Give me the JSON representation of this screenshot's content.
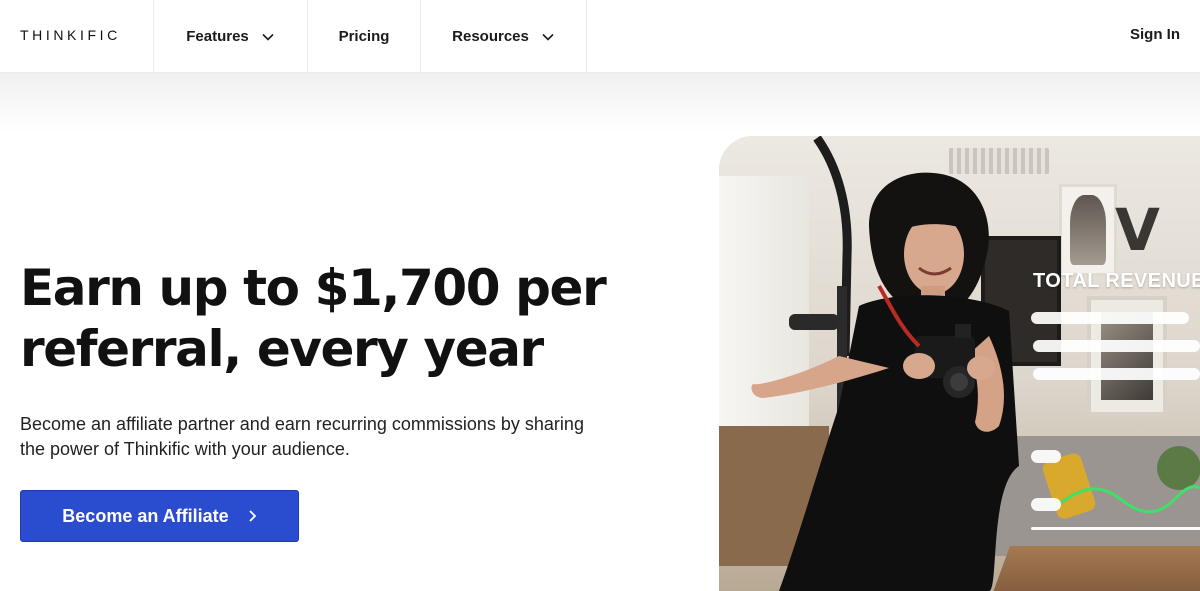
{
  "nav": {
    "logo": "THINKIFIC",
    "items": [
      {
        "label": "Features",
        "has_dropdown": true
      },
      {
        "label": "Pricing",
        "has_dropdown": false
      },
      {
        "label": "Resources",
        "has_dropdown": true
      }
    ],
    "sign_in": "Sign In"
  },
  "hero": {
    "headline_line1": "Earn up to $1,700 per",
    "headline_line2": "referral, every year",
    "subtext_line1": "Become an affiliate partner and earn recurring commissions by sharing",
    "subtext_line2": "the power of Thinkific with your audience.",
    "cta_label": "Become an Affiliate"
  },
  "image": {
    "overlay_title": "TOTAL REVENUE",
    "chart_line_color": "#3ee06a"
  },
  "colors": {
    "accent": "#2a4ccf",
    "text": "#111111"
  }
}
